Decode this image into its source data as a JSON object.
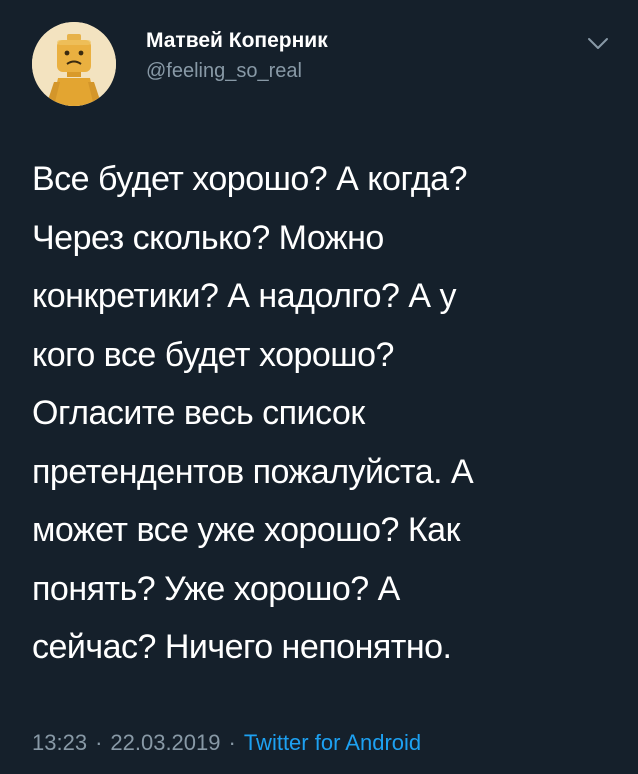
{
  "tweet": {
    "author": {
      "display_name": "Матвей Коперник",
      "handle": "@feeling_so_real",
      "avatar_icon": "lego-figure-avatar"
    },
    "menu_icon": "chevron-down-icon",
    "text_lines": [
      "Все будет хорошо? А когда?",
      "Через сколько? Можно",
      "конкретики? А надолго? А у",
      "кого все будет хорошо?",
      "Огласите весь список",
      "претендентов пожалуйста. А",
      "может все уже хорошо? Как",
      "понять? Уже хорошо? А",
      "сейчас? Ничего непонятно."
    ],
    "time": "13:23",
    "separator": "·",
    "date": "22.03.2019",
    "source": "Twitter for Android"
  },
  "colors": {
    "background": "#15202b",
    "text_primary": "#ffffff",
    "text_secondary": "#8899a6",
    "link": "#1da1f2",
    "avatar_bg": "#f3e3c0",
    "avatar_figure": "#e0a52a"
  }
}
